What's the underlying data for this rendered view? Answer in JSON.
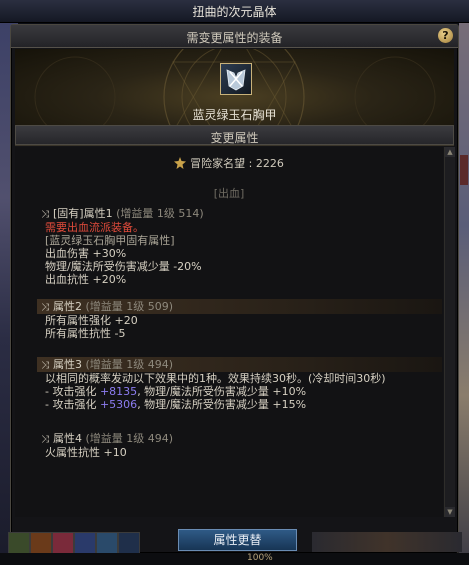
{
  "top_title": "扭曲的次元晶体",
  "window": {
    "title": "需变更属性的装备",
    "help_label": "?",
    "item_name": "蓝灵绿玉石胸甲",
    "subheader": "变更属性",
    "fame_label": "冒险家名望 : 2226",
    "section_label": "[出血]"
  },
  "attributes": [
    {
      "head": "[固有]属性1",
      "gain": "(增益量 1级 514)",
      "lines": [
        {
          "text": "需要出血流派装备。",
          "style": "req"
        },
        {
          "text": "[蓝灵绿玉石胸甲固有属性]",
          "style": "sub"
        },
        {
          "text": "出血伤害 +30%",
          "style": "normal"
        },
        {
          "text": "物理/魔法所受伤害减少量 -20%",
          "style": "normal"
        },
        {
          "text": "出血抗性 +20%",
          "style": "normal"
        }
      ]
    },
    {
      "head": "属性2",
      "gain": "(增益量 1级 509)",
      "lines": [
        {
          "text": "所有属性强化 +20",
          "style": "normal"
        },
        {
          "text": "所有属性抗性 -5",
          "style": "normal"
        }
      ]
    },
    {
      "head": "属性3",
      "gain": "(增益量 1级 494)",
      "lines": [
        {
          "text": "以相同的概率发动以下效果中的1种。效果持续30秒。(冷却时间30秒)",
          "style": "normal"
        },
        {
          "prefix": "- 攻击强化 ",
          "hl": "+8135",
          "suffix": ", 物理/魔法所受伤害减少量 +10%",
          "style": "mixed"
        },
        {
          "prefix": "- 攻击强化 ",
          "hl": "+5306",
          "suffix": ", 物理/魔法所受伤害减少量 +15%",
          "style": "mixed"
        }
      ]
    },
    {
      "head": "属性4",
      "gain": "(增益量 1级 494)",
      "lines": [
        {
          "text": "火属性抗性 +10",
          "style": "normal"
        }
      ]
    }
  ],
  "change_button": "属性更替",
  "bottom_percent": "100%",
  "colors": {
    "required_text": "#e14b3b",
    "highlight_value": "#8c7cf0",
    "button": "#2f5a86"
  }
}
